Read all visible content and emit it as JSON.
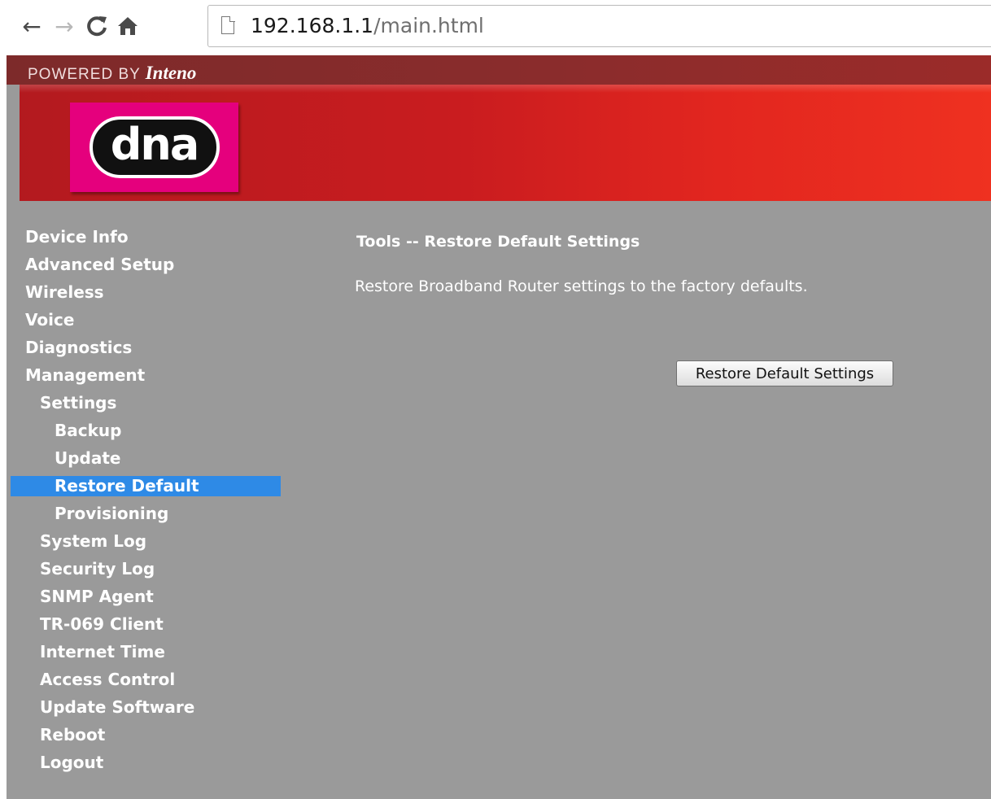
{
  "browser": {
    "back_icon": "←",
    "forward_icon": "→",
    "reload_icon": "C",
    "home_icon": "🏠",
    "url_host": "192.168.1.1",
    "url_path": "/main.html"
  },
  "header": {
    "powered_by": "POWERED BY ",
    "brand": "Inteno",
    "logo_text": "dna",
    "colors": {
      "top_strip": "#8a2c2c",
      "banner_red": "#e2261f",
      "logo_pink": "#e5007d",
      "page_gray": "#9a9a9a",
      "active_blue": "#2e8ae6"
    }
  },
  "sidebar": {
    "items": [
      {
        "label": "Device Info"
      },
      {
        "label": "Advanced Setup"
      },
      {
        "label": "Wireless"
      },
      {
        "label": "Voice"
      },
      {
        "label": "Diagnostics"
      },
      {
        "label": "Management"
      },
      {
        "label": "Settings"
      },
      {
        "label": "Backup"
      },
      {
        "label": "Update"
      },
      {
        "label": "Restore Default"
      },
      {
        "label": "Provisioning"
      },
      {
        "label": "System Log"
      },
      {
        "label": "Security Log"
      },
      {
        "label": "SNMP Agent"
      },
      {
        "label": "TR-069 Client"
      },
      {
        "label": "Internet Time"
      },
      {
        "label": "Access Control"
      },
      {
        "label": "Update Software"
      },
      {
        "label": "Reboot"
      },
      {
        "label": "Logout"
      }
    ]
  },
  "content": {
    "title": "Tools -- Restore Default Settings",
    "description": "Restore Broadband Router settings to the factory defaults.",
    "button_label": "Restore Default Settings"
  }
}
